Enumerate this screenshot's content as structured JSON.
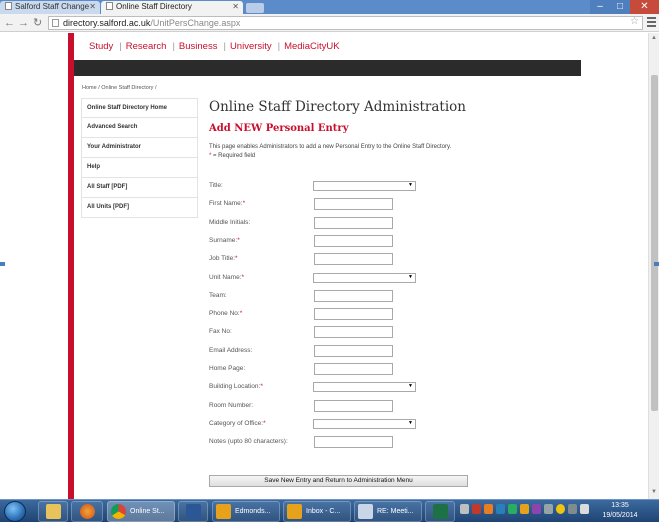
{
  "browser": {
    "tabs": [
      {
        "label": "Salford Staff Change",
        "active": false
      },
      {
        "label": "Online Staff Directory",
        "active": true
      }
    ],
    "url_domain": "directory.salford.ac.uk",
    "url_path": "/UnitPersChange.aspx"
  },
  "site_nav": {
    "items": [
      "Study",
      "Research",
      "Business",
      "University",
      "MediaCityUK"
    ],
    "separator": "|"
  },
  "breadcrumb": "Home / Online Staff Directory /",
  "sidebar": {
    "items": [
      {
        "label": "Online Staff Directory Home"
      },
      {
        "label": "Advanced Search"
      },
      {
        "label": "Your Administrator"
      },
      {
        "label": "Help"
      },
      {
        "label": "All Staff [PDF]"
      },
      {
        "label": "All Units [PDF]"
      }
    ]
  },
  "page": {
    "title": "Online Staff Directory Administration",
    "subtitle": "Add NEW Personal Entry",
    "intro": "This page enables Administrators to add a new Personal Entry to the Online Staff Directory.",
    "required_star": "*",
    "required_note": " = Required field"
  },
  "form": {
    "fields": [
      {
        "label": "Title:",
        "required": false,
        "type": "select",
        "value": ""
      },
      {
        "label": "First Name:",
        "required": true,
        "type": "text",
        "value": ""
      },
      {
        "label": "Middle Initials:",
        "required": false,
        "type": "text",
        "value": ""
      },
      {
        "label": "Surname:",
        "required": true,
        "type": "text",
        "value": ""
      },
      {
        "label": "Job Title:",
        "required": true,
        "type": "text",
        "value": ""
      },
      {
        "label": "Unit Name:",
        "required": true,
        "type": "select",
        "value": ""
      },
      {
        "label": "Team:",
        "required": false,
        "type": "text",
        "value": ""
      },
      {
        "label": "Phone No:",
        "required": true,
        "type": "text",
        "value": ""
      },
      {
        "label": "Fax No:",
        "required": false,
        "type": "text",
        "value": ""
      },
      {
        "label": "Email Address:",
        "required": false,
        "type": "text",
        "value": ""
      },
      {
        "label": "Home Page:",
        "required": false,
        "type": "text",
        "value": ""
      },
      {
        "label": "Building Location:",
        "required": true,
        "type": "select",
        "value": ""
      },
      {
        "label": "Room Number:",
        "required": false,
        "type": "text",
        "value": ""
      },
      {
        "label": "Category of Office:",
        "required": true,
        "type": "select",
        "value": ""
      },
      {
        "label": "Notes (upto 80 characters):",
        "required": false,
        "type": "text",
        "value": ""
      }
    ],
    "submit_label": "Save New Entry and Return to Administration Menu"
  },
  "taskbar": {
    "buttons": [
      {
        "label": "",
        "icon": "folder-icon",
        "active": false
      },
      {
        "label": "",
        "icon": "firefox-icon",
        "active": false
      },
      {
        "label": "Online St...",
        "icon": "chrome-icon",
        "active": true
      },
      {
        "label": "",
        "icon": "word-icon",
        "active": false
      },
      {
        "label": "Edmonds...",
        "icon": "outlook-icon",
        "active": false
      },
      {
        "label": "Inbox - C...",
        "icon": "outlook-icon",
        "active": false
      },
      {
        "label": "RE: Meeti...",
        "icon": "email-icon",
        "active": false
      },
      {
        "label": "",
        "icon": "excel-icon",
        "active": false
      }
    ],
    "time": "13:35",
    "date": "19/05/2014"
  },
  "colors": {
    "brand_red": "#c8102e",
    "dark_bar": "#2b2b2b",
    "taskbar": "#1f4473"
  }
}
